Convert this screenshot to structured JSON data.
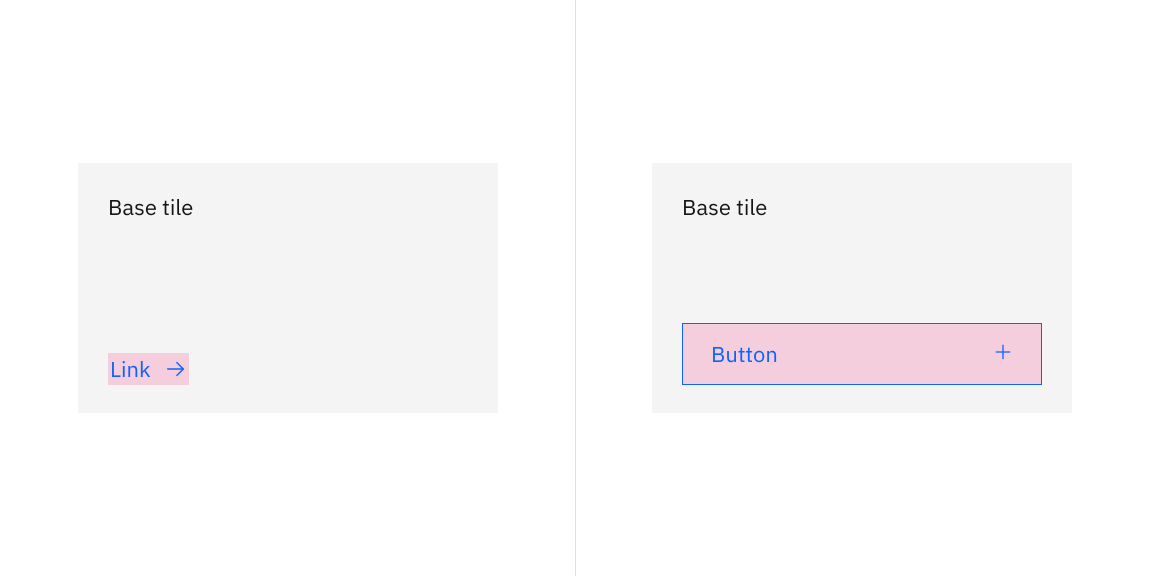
{
  "left": {
    "tile_title": "Base tile",
    "link_label": "Link"
  },
  "right": {
    "tile_title": "Base tile",
    "button_label": "Button"
  },
  "colors": {
    "tile_bg": "#f4f4f4",
    "highlight_bg": "#f4cedd",
    "accent": "#0f62fe",
    "text": "#161616",
    "divider": "#e0e0e0"
  }
}
